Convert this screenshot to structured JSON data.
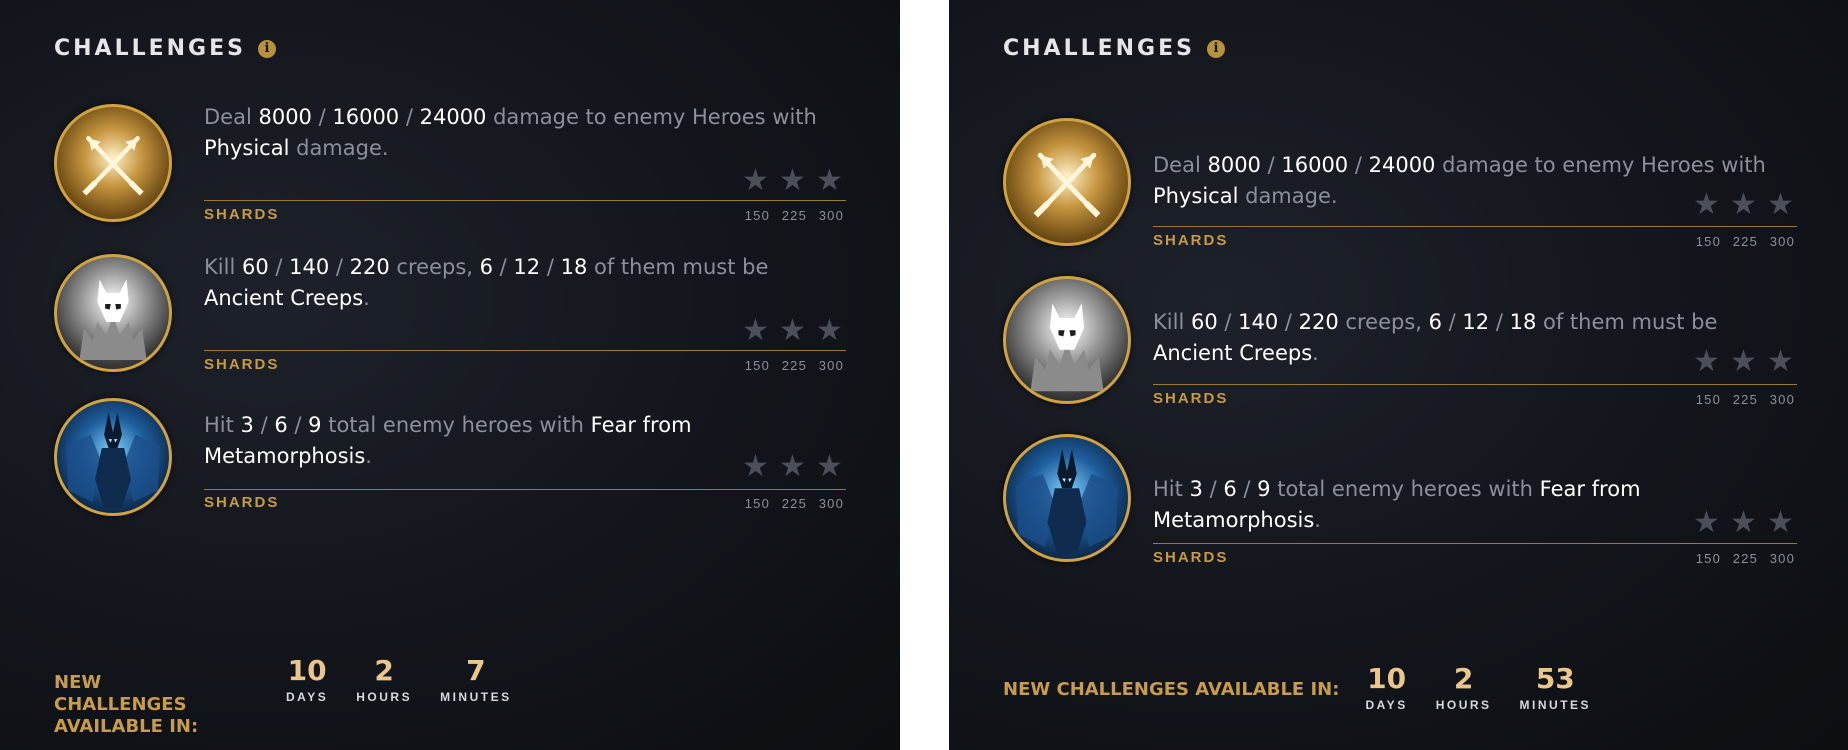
{
  "panels": [
    {
      "title": "CHALLENGES",
      "info_icon": "i",
      "challenges": [
        {
          "icon": "physical-damage-icon",
          "desc": [
            {
              "text": "Deal ",
              "hl": false
            },
            {
              "text": "8000",
              "hl": true
            },
            {
              "text": " / ",
              "hl": false
            },
            {
              "text": "16000",
              "hl": true
            },
            {
              "text": " / ",
              "hl": false
            },
            {
              "text": "24000",
              "hl": true
            },
            {
              "text": " damage to enemy Heroes with ",
              "hl": false
            },
            {
              "text": "Physical",
              "hl": true
            },
            {
              "text": " damage.",
              "hl": false
            }
          ],
          "stars_earned": 0,
          "reward_label": "SHARDS",
          "tiers": [
            "150",
            "225",
            "300"
          ]
        },
        {
          "icon": "ancient-creeps-icon",
          "desc": [
            {
              "text": "Kill ",
              "hl": false
            },
            {
              "text": "60",
              "hl": true
            },
            {
              "text": " / ",
              "hl": false
            },
            {
              "text": "140",
              "hl": true
            },
            {
              "text": " / ",
              "hl": false
            },
            {
              "text": "220",
              "hl": true
            },
            {
              "text": " creeps, ",
              "hl": false
            },
            {
              "text": "6",
              "hl": true
            },
            {
              "text": " / ",
              "hl": false
            },
            {
              "text": "12",
              "hl": true
            },
            {
              "text": " / ",
              "hl": false
            },
            {
              "text": "18",
              "hl": true
            },
            {
              "text": " of them must be ",
              "hl": false
            },
            {
              "text": "Ancient Creeps",
              "hl": true
            },
            {
              "text": ".",
              "hl": false
            }
          ],
          "stars_earned": 0,
          "reward_label": "SHARDS",
          "tiers": [
            "150",
            "225",
            "300"
          ]
        },
        {
          "icon": "metamorphosis-hero-icon",
          "desc": [
            {
              "text": "Hit ",
              "hl": false
            },
            {
              "text": "3",
              "hl": true
            },
            {
              "text": " / ",
              "hl": false
            },
            {
              "text": "6",
              "hl": true
            },
            {
              "text": " / ",
              "hl": false
            },
            {
              "text": "9",
              "hl": true
            },
            {
              "text": " total enemy heroes with ",
              "hl": false
            },
            {
              "text": "Fear from Metamorphosis",
              "hl": true
            },
            {
              "text": ".",
              "hl": false
            }
          ],
          "stars_earned": 0,
          "reward_label": "SHARDS",
          "tiers": [
            "150",
            "225",
            "300"
          ]
        }
      ],
      "footer": {
        "label_lines": [
          "NEW CHALLENGES",
          "AVAILABLE IN:"
        ],
        "countdown": [
          {
            "value": "10",
            "label": "DAYS"
          },
          {
            "value": "2",
            "label": "HOURS"
          },
          {
            "value": "7",
            "label": "MINUTES"
          }
        ]
      }
    },
    {
      "title": "CHALLENGES",
      "info_icon": "i",
      "challenges": [
        {
          "icon": "physical-damage-icon",
          "desc": [
            {
              "text": "Deal ",
              "hl": false
            },
            {
              "text": "8000",
              "hl": true
            },
            {
              "text": " / ",
              "hl": false
            },
            {
              "text": "16000",
              "hl": true
            },
            {
              "text": " / ",
              "hl": false
            },
            {
              "text": "24000",
              "hl": true
            },
            {
              "text": " damage to enemy Heroes with ",
              "hl": false
            },
            {
              "text": "Physical",
              "hl": true
            },
            {
              "text": " damage.",
              "hl": false
            }
          ],
          "stars_earned": 0,
          "reward_label": "SHARDS",
          "tiers": [
            "150",
            "225",
            "300"
          ]
        },
        {
          "icon": "ancient-creeps-icon",
          "desc": [
            {
              "text": "Kill ",
              "hl": false
            },
            {
              "text": "60",
              "hl": true
            },
            {
              "text": " / ",
              "hl": false
            },
            {
              "text": "140",
              "hl": true
            },
            {
              "text": " / ",
              "hl": false
            },
            {
              "text": "220",
              "hl": true
            },
            {
              "text": " creeps, ",
              "hl": false
            },
            {
              "text": "6",
              "hl": true
            },
            {
              "text": " / ",
              "hl": false
            },
            {
              "text": "12",
              "hl": true
            },
            {
              "text": " / ",
              "hl": false
            },
            {
              "text": "18",
              "hl": true
            },
            {
              "text": " of them must be ",
              "hl": false
            },
            {
              "text": "Ancient Creeps",
              "hl": true
            },
            {
              "text": ".",
              "hl": false
            }
          ],
          "stars_earned": 0,
          "reward_label": "SHARDS",
          "tiers": [
            "150",
            "225",
            "300"
          ]
        },
        {
          "icon": "metamorphosis-hero-icon",
          "desc": [
            {
              "text": "Hit ",
              "hl": false
            },
            {
              "text": "3",
              "hl": true
            },
            {
              "text": " / ",
              "hl": false
            },
            {
              "text": "6",
              "hl": true
            },
            {
              "text": " / ",
              "hl": false
            },
            {
              "text": "9",
              "hl": true
            },
            {
              "text": " total enemy heroes with ",
              "hl": false
            },
            {
              "text": "Fear from Metamorphosis",
              "hl": true
            },
            {
              "text": ".",
              "hl": false
            }
          ],
          "stars_earned": 0,
          "reward_label": "SHARDS",
          "tiers": [
            "150",
            "225",
            "300"
          ]
        }
      ],
      "footer": {
        "label_lines": [
          "NEW CHALLENGES AVAILABLE IN:"
        ],
        "countdown": [
          {
            "value": "10",
            "label": "DAYS"
          },
          {
            "value": "2",
            "label": "HOURS"
          },
          {
            "value": "53",
            "label": "MINUTES"
          }
        ]
      }
    }
  ]
}
